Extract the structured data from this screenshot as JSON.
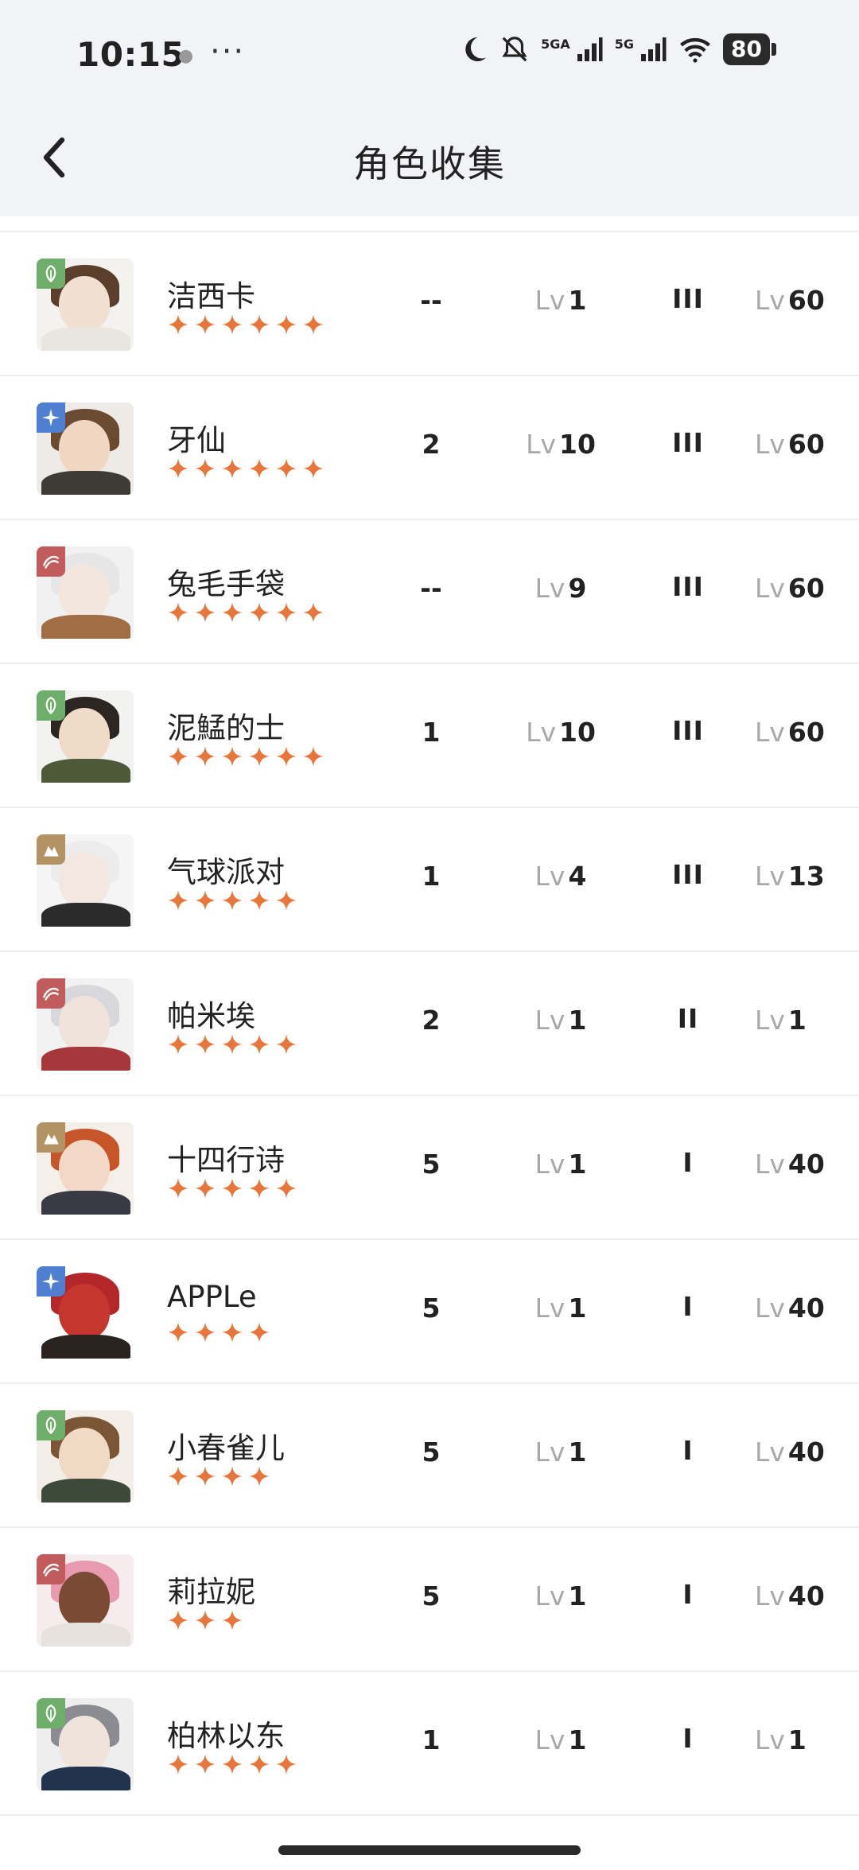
{
  "status_bar": {
    "time": "10:15",
    "more": "···",
    "battery": "80",
    "signal1_label": "5GA",
    "signal2_label": "5G"
  },
  "header": {
    "title": "角色收集"
  },
  "characters": [
    {
      "name": "洁西卡",
      "stars": 6,
      "rank": "--",
      "level_prefix": "Lv",
      "level": "1",
      "insight": "III",
      "max_prefix": "Lv",
      "max_level": "60",
      "element": "plant",
      "element_color": "#6fae6a",
      "palette": {
        "hair": "#5b3f2c",
        "face": "#f1dfd1",
        "body": "#e9e6e0",
        "bg": "#f4f2ee"
      }
    },
    {
      "name": "牙仙",
      "stars": 6,
      "rank": "2",
      "level_prefix": "Lv",
      "level": "10",
      "insight": "III",
      "max_prefix": "Lv",
      "max_level": "60",
      "element": "star",
      "element_color": "#4f7fd1",
      "palette": {
        "hair": "#6b4a32",
        "face": "#efd7c4",
        "body": "#3e3a35",
        "bg": "#eeebe6"
      }
    },
    {
      "name": "兔毛手袋",
      "stars": 6,
      "rank": "--",
      "level_prefix": "Lv",
      "level": "9",
      "insight": "III",
      "max_prefix": "Lv",
      "max_level": "60",
      "element": "beast",
      "element_color": "#c25b5b",
      "palette": {
        "hair": "#e6e6e6",
        "face": "#f3e6dc",
        "body": "#a06d45",
        "bg": "#f1f1f1"
      }
    },
    {
      "name": "泥鯭的士",
      "stars": 6,
      "rank": "1",
      "level_prefix": "Lv",
      "level": "10",
      "insight": "III",
      "max_prefix": "Lv",
      "max_level": "60",
      "element": "plant",
      "element_color": "#6fae6a",
      "palette": {
        "hair": "#2b2622",
        "face": "#f0dac8",
        "body": "#4c5a3a",
        "bg": "#f2f2f0"
      }
    },
    {
      "name": "气球派对",
      "stars": 5,
      "rank": "1",
      "level_prefix": "Lv",
      "level": "4",
      "insight": "III",
      "max_prefix": "Lv",
      "max_level": "13",
      "element": "mineral",
      "element_color": "#b39364",
      "palette": {
        "hair": "#ececec",
        "face": "#f3e8e1",
        "body": "#2b2b2b",
        "bg": "#f5f5f5"
      }
    },
    {
      "name": "帕米埃",
      "stars": 5,
      "rank": "2",
      "level_prefix": "Lv",
      "level": "1",
      "insight": "II",
      "max_prefix": "Lv",
      "max_level": "1",
      "element": "beast",
      "element_color": "#c25b5b",
      "palette": {
        "hair": "#d8d8dc",
        "face": "#efe3dc",
        "body": "#a6373a",
        "bg": "#f2f2f2"
      }
    },
    {
      "name": "十四行诗",
      "stars": 5,
      "rank": "5",
      "level_prefix": "Lv",
      "level": "1",
      "insight": "I",
      "max_prefix": "Lv",
      "max_level": "40",
      "element": "mineral",
      "element_color": "#b39364",
      "palette": {
        "hair": "#c7552a",
        "face": "#f2d8c6",
        "body": "#3a3a44",
        "bg": "#f5efe9"
      }
    },
    {
      "name": "APPLe",
      "stars": 4,
      "rank": "5",
      "level_prefix": "Lv",
      "level": "1",
      "insight": "I",
      "max_prefix": "Lv",
      "max_level": "40",
      "element": "star",
      "element_color": "#4f7fd1",
      "palette": {
        "hair": "#b3262a",
        "face": "#c4362f",
        "body": "#2a2320",
        "bg": "#ffffff"
      }
    },
    {
      "name": "小春雀儿",
      "stars": 4,
      "rank": "5",
      "level_prefix": "Lv",
      "level": "1",
      "insight": "I",
      "max_prefix": "Lv",
      "max_level": "40",
      "element": "plant",
      "element_color": "#6fae6a",
      "palette": {
        "hair": "#7a5636",
        "face": "#f0dac5",
        "body": "#3d4a3a",
        "bg": "#f3efe8"
      }
    },
    {
      "name": "莉拉妮",
      "stars": 3,
      "rank": "5",
      "level_prefix": "Lv",
      "level": "1",
      "insight": "I",
      "max_prefix": "Lv",
      "max_level": "40",
      "element": "beast",
      "element_color": "#c25b5b",
      "palette": {
        "hair": "#e89ab0",
        "face": "#7a4a35",
        "body": "#e7e2de",
        "bg": "#f6ecee"
      }
    },
    {
      "name": "柏林以东",
      "stars": 5,
      "rank": "1",
      "level_prefix": "Lv",
      "level": "1",
      "insight": "I",
      "max_prefix": "Lv",
      "max_level": "1",
      "element": "plant",
      "element_color": "#6fae6a",
      "palette": {
        "hair": "#8a8c92",
        "face": "#efe3dc",
        "body": "#22334d",
        "bg": "#eeeeee"
      }
    }
  ],
  "colors": {
    "star": "#e8763a",
    "header_bg": "#f2f3f6",
    "muted_text": "#a8a8a8"
  }
}
